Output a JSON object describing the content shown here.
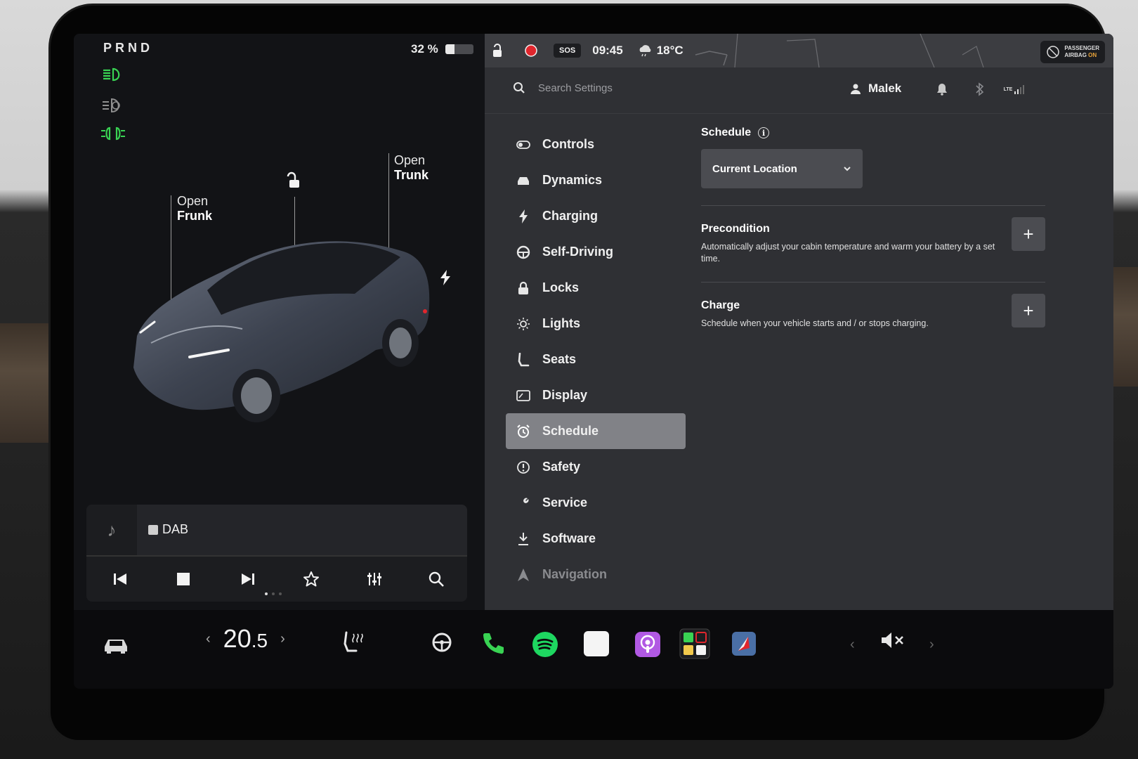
{
  "colors": {
    "accent_green": "#39d353",
    "active_menu": "#818287",
    "airbag_on": "#e8a33a",
    "record_red": "#e0262d",
    "spotify_green": "#1ed760",
    "podcast_purple": "#b159e3"
  },
  "left": {
    "gear": "PRND",
    "battery": {
      "percent_label": "32 %",
      "level": 0.32
    },
    "labels": {
      "frunk_top": "Open",
      "frunk_bottom": "Frunk",
      "trunk_top": "Open",
      "trunk_bottom": "Trunk"
    },
    "media": {
      "source": "DAB"
    }
  },
  "status": {
    "time": "09:45",
    "temperature": "18°C",
    "sos": "SOS",
    "airbag_line1": "PASSENGER",
    "airbag_line2": "AIRBAG",
    "airbag_state": "ON"
  },
  "topbar": {
    "search_placeholder": "Search Settings",
    "user": "Malek",
    "network": "LTE"
  },
  "menu": {
    "items": [
      {
        "label": "Controls",
        "icon": "toggle-icon"
      },
      {
        "label": "Dynamics",
        "icon": "car-icon"
      },
      {
        "label": "Charging",
        "icon": "bolt-icon"
      },
      {
        "label": "Self-Driving",
        "icon": "steering-wheel-icon"
      },
      {
        "label": "Locks",
        "icon": "lock-icon"
      },
      {
        "label": "Lights",
        "icon": "sun-icon"
      },
      {
        "label": "Seats",
        "icon": "seat-icon"
      },
      {
        "label": "Display",
        "icon": "display-icon"
      },
      {
        "label": "Schedule",
        "icon": "alarm-clock-icon",
        "active": true
      },
      {
        "label": "Safety",
        "icon": "alert-circle-icon"
      },
      {
        "label": "Service",
        "icon": "wrench-icon"
      },
      {
        "label": "Software",
        "icon": "download-icon"
      },
      {
        "label": "Navigation",
        "icon": "navigation-arrow-icon"
      }
    ]
  },
  "schedule": {
    "heading": "Schedule",
    "location": "Current Location",
    "precondition": {
      "title": "Precondition",
      "desc": "Automatically adjust your cabin temperature and warm your battery by a set time."
    },
    "charge": {
      "title": "Charge",
      "desc": "Schedule when your vehicle starts and / or stops charging."
    },
    "add_label": "+"
  },
  "dock": {
    "cabin_temp_int": "20",
    "cabin_temp_dec": ".5"
  }
}
